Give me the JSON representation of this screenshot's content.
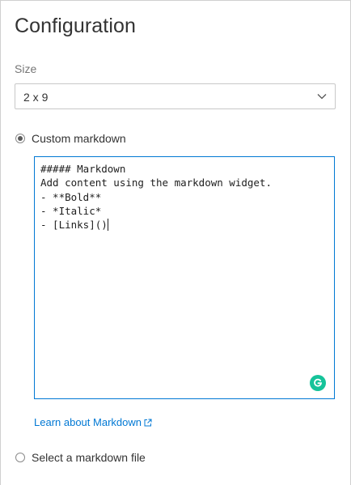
{
  "panel": {
    "title": "Configuration"
  },
  "size": {
    "label": "Size",
    "selected": "2 x 9",
    "icon": "chevron-down-icon"
  },
  "source_options": [
    {
      "label": "Custom markdown",
      "checked": true
    },
    {
      "label": "Select a markdown file",
      "checked": false
    }
  ],
  "editor": {
    "content": "##### Markdown\nAdd content using the markdown widget.\n- **Bold**\n- *Italic*\n- [Links]()",
    "assistant_icon": "grammarly-icon",
    "assistant_color": "#15c39a",
    "border_color": "#0078d4"
  },
  "learn_link": {
    "label": "Learn about Markdown",
    "icon": "external-link-icon",
    "color": "#0078d4"
  }
}
